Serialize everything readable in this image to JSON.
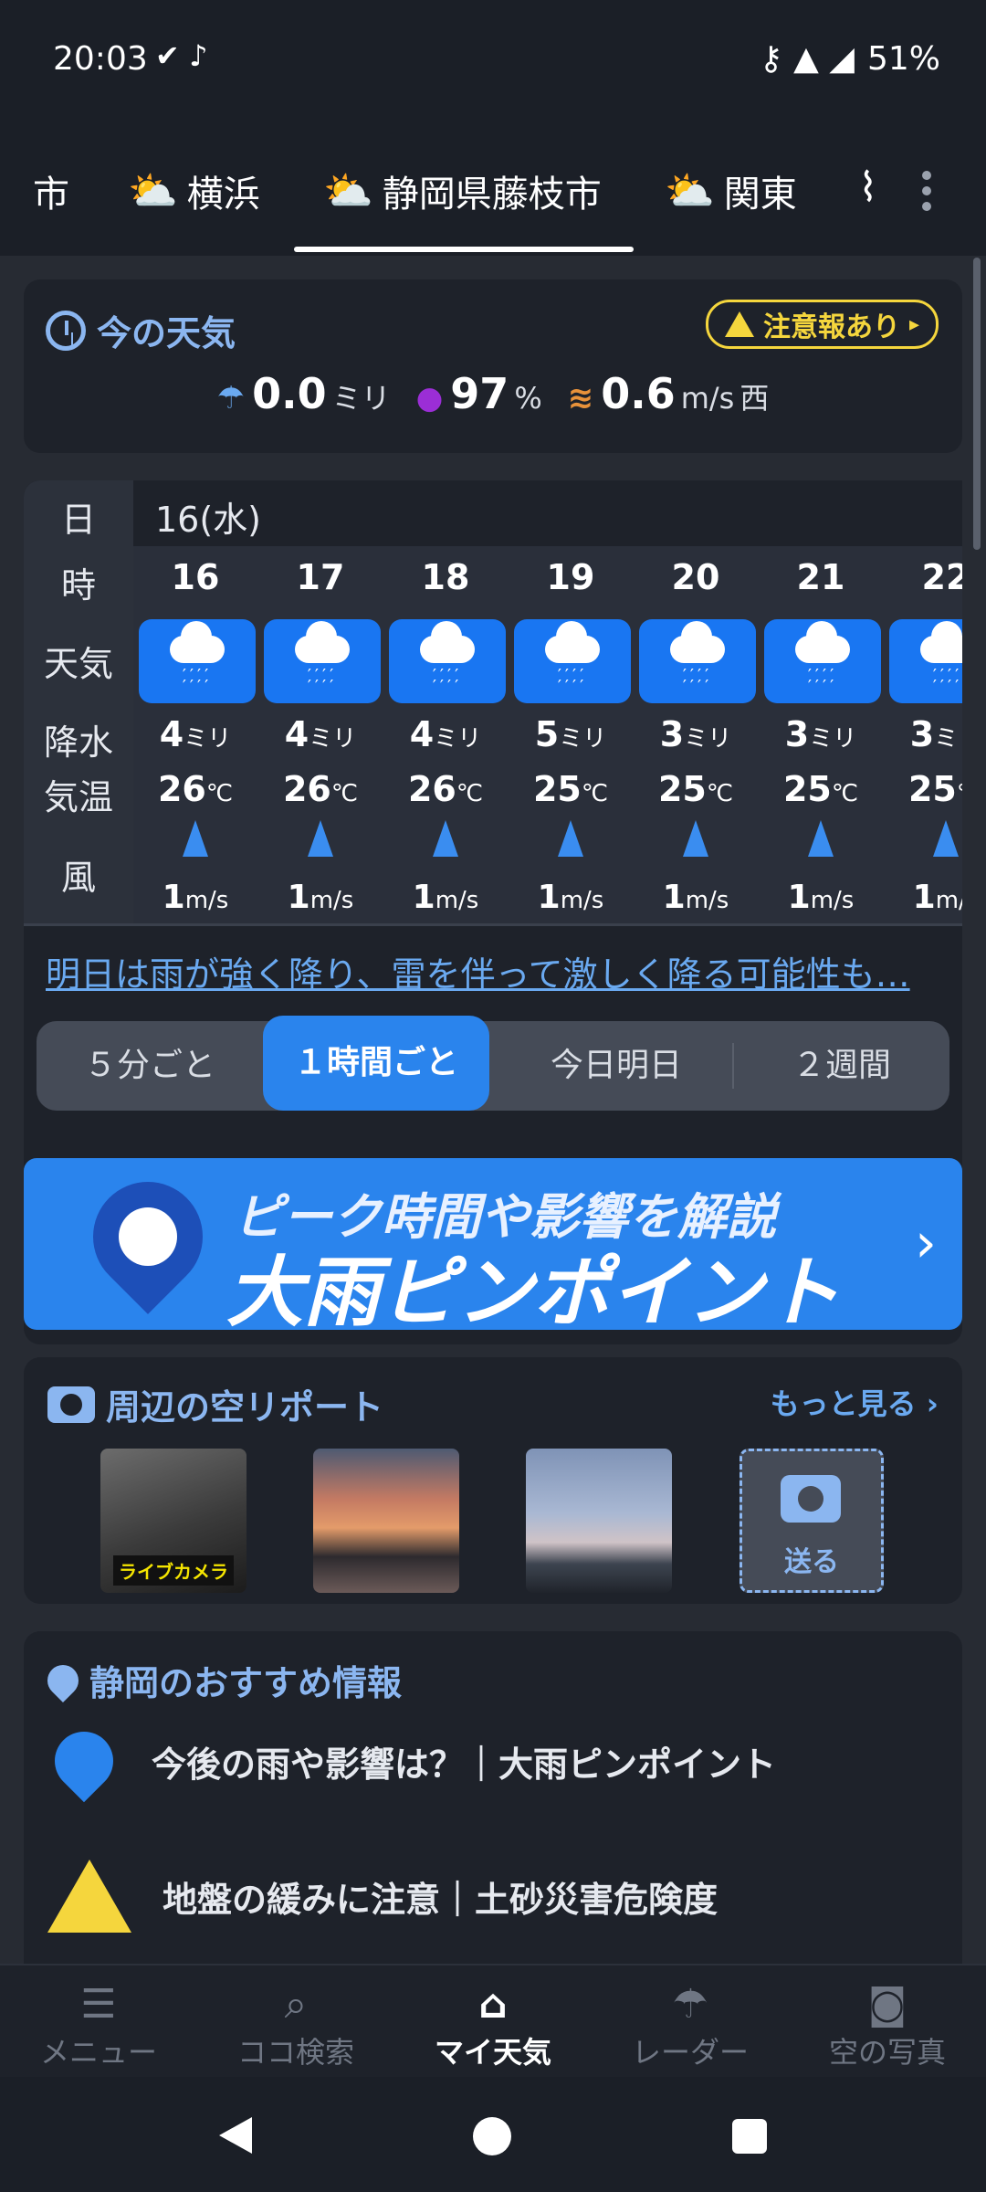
{
  "status": {
    "time": "20:03",
    "left_icons": "✔ ♪",
    "right_icons": "⚷ ▲ ◢",
    "battery": "51%"
  },
  "tabs": [
    {
      "label": "市"
    },
    {
      "label": "横浜"
    },
    {
      "label": "静岡県藤枝市"
    },
    {
      "label": "関東"
    }
  ],
  "now": {
    "title": "今の天気",
    "alert": "注意報あり",
    "rain_value": "0.0",
    "rain_unit": "ミリ",
    "humidity_value": "97",
    "humidity_unit": "%",
    "wind_value": "0.6",
    "wind_unit": "m/s",
    "wind_dir": "西"
  },
  "forecast": {
    "labels": {
      "day": "日",
      "hour": "時",
      "weather": "天気",
      "precip": "降水",
      "temp": "気温",
      "wind": "風"
    },
    "day": "16(水)",
    "hours": [
      {
        "hour": "16",
        "precip": "4",
        "temp": "26",
        "wind": "1"
      },
      {
        "hour": "17",
        "precip": "4",
        "temp": "26",
        "wind": "1"
      },
      {
        "hour": "18",
        "precip": "4",
        "temp": "26",
        "wind": "1"
      },
      {
        "hour": "19",
        "precip": "5",
        "temp": "25",
        "wind": "1"
      },
      {
        "hour": "20",
        "precip": "3",
        "temp": "25",
        "wind": "1"
      },
      {
        "hour": "21",
        "precip": "3",
        "temp": "25",
        "wind": "1"
      },
      {
        "hour": "22",
        "precip": "3",
        "temp": "25",
        "wind": "1"
      }
    ],
    "units": {
      "precip": "ミリ",
      "temp": "℃",
      "wind": "m/s"
    },
    "link": "明日は雨が強く降り、雷を伴って激しく降る可能性も…",
    "segments": [
      "５分ごと",
      "１時間ごと",
      "今日明日",
      "２週間"
    ]
  },
  "banner": {
    "subtitle": "ピーク時間や影響を解説",
    "title": "大雨ピンポイント",
    "chevron": "›"
  },
  "sky": {
    "title": "周辺の空リポート",
    "more": "もっと見る ›",
    "live_label": "ライブカメラ",
    "send": "送る"
  },
  "recommend": {
    "title": "静岡のおすすめ情報",
    "items": [
      {
        "text": "今後の雨や影響は？｜大雨ピンポイント"
      },
      {
        "text": "地盤の緩みに注意｜土砂災害危険度"
      }
    ]
  },
  "bottom_nav": [
    {
      "label": "メニュー",
      "icon": "☰"
    },
    {
      "label": "ココ検索",
      "icon": "⌕"
    },
    {
      "label": "マイ天気",
      "icon": "⌂"
    },
    {
      "label": "レーダー",
      "icon": "☂"
    },
    {
      "label": "空の写真",
      "icon": "◙"
    }
  ],
  "colors": {
    "accent": "#2a84ed",
    "warning": "#f5d63d",
    "link": "#6aa9f0"
  }
}
